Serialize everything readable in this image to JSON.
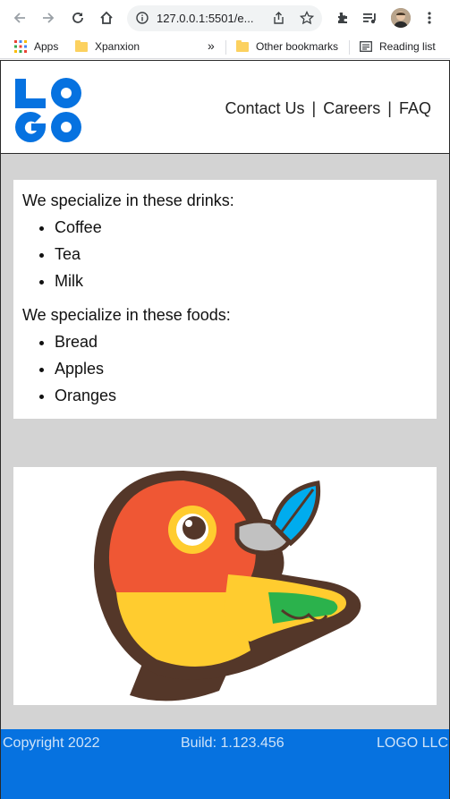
{
  "browser": {
    "url": "127.0.0.1:5501/e...",
    "bookmarks": {
      "apps": "Apps",
      "folder1": "Xpanxion",
      "overflow": "»",
      "other": "Other bookmarks",
      "reading": "Reading list"
    }
  },
  "header": {
    "logo_text": "LOGO",
    "nav": [
      "Contact Us",
      "Careers",
      "FAQ"
    ],
    "separator": "|"
  },
  "content": {
    "drinks_intro": "We specialize in these drinks:",
    "drinks": [
      "Coffee",
      "Tea",
      "Milk"
    ],
    "foods_intro": "We specialize in these foods:",
    "foods": [
      "Bread",
      "Apples",
      "Oranges"
    ]
  },
  "footer": {
    "copyright": "Copyright 2022",
    "build": "Build: 1.123.456",
    "company": "LOGO LLC"
  },
  "colors": {
    "logo_blue": "#0672e0",
    "page_bg": "#d3d3d3",
    "footer_bg": "#0672e0",
    "footer_text": "#cfe3f8"
  }
}
